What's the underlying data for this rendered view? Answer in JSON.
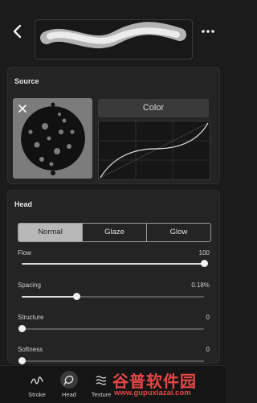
{
  "topbar": {
    "back_icon": "chevron-left-icon",
    "more_icon": "more-dots-icon"
  },
  "source": {
    "title": "Source",
    "color_label": "Color"
  },
  "head": {
    "title": "Head",
    "modes": [
      "Normal",
      "Glaze",
      "Glow"
    ],
    "active_mode": "Normal",
    "sliders": [
      {
        "label": "Flow",
        "value": "100",
        "fraction": 1.0
      },
      {
        "label": "Spacing",
        "value": "0.18%",
        "fraction": 0.3
      },
      {
        "label": "Structure",
        "value": "0",
        "fraction": 0.0
      },
      {
        "label": "Softness",
        "value": "0",
        "fraction": 0.0
      }
    ]
  },
  "tabs": [
    {
      "label": "Stroke",
      "icon": "stroke-icon",
      "active": false
    },
    {
      "label": "Head",
      "icon": "head-icon",
      "active": true
    },
    {
      "label": "Texture",
      "icon": "texture-icon",
      "active": false
    }
  ],
  "watermark": {
    "line1": "谷普软件园",
    "line2": "www.gupuxiazai.com"
  },
  "colors": {
    "background": "#1b1b1b",
    "card": "#242424",
    "accent": "#b8b8b8",
    "watermark": "#e64646"
  }
}
